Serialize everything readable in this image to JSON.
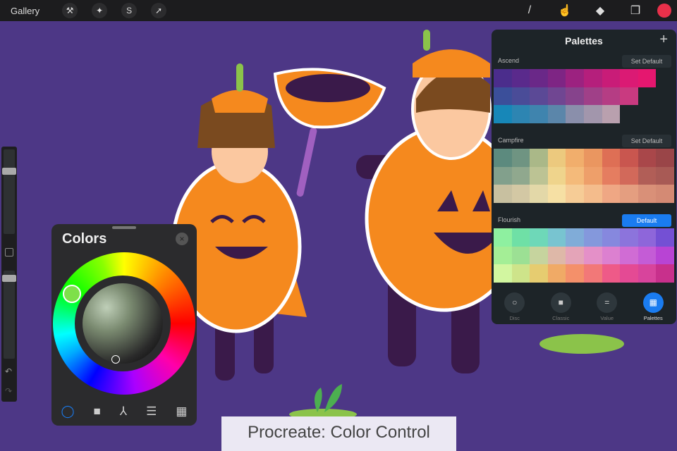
{
  "topbar": {
    "gallery": "Gallery",
    "left_icons": [
      "wrench-icon",
      "magic-wand-icon",
      "selection-icon",
      "transform-arrow-icon"
    ],
    "right_icons": [
      "brush-icon",
      "smudge-icon",
      "eraser-icon",
      "layers-icon"
    ],
    "current_color": "#e8304a"
  },
  "colors_panel": {
    "title": "Colors",
    "close": "×",
    "tabs": [
      "disc-icon",
      "classic-icon",
      "harmony-icon",
      "value-icon",
      "palettes-icon"
    ]
  },
  "palettes_panel": {
    "title": "Palettes",
    "add": "+",
    "palettes": [
      {
        "name": "Ascend",
        "button": "Set Default",
        "rows": [
          [
            "#4b2d8c",
            "#5a2a8c",
            "#6a2888",
            "#7e2584",
            "#9c2280",
            "#b51f7c",
            "#c91c78",
            "#db1a74",
            "#e5176f"
          ],
          [
            "#3b4f9a",
            "#4a4c98",
            "#5b4996",
            "#704692",
            "#86438c",
            "#a04088",
            "#b53d84",
            "#c93a80"
          ],
          [
            "#1787b8",
            "#2d85b2",
            "#3f84ae",
            "#5b86aa",
            "#8a8fab",
            "#a296ac",
            "#b9a0ae"
          ]
        ]
      },
      {
        "name": "Campfire",
        "button": "Set Default",
        "rows": [
          [
            "#5c8a7e",
            "#6f9482",
            "#aab888",
            "#ecc97e",
            "#f1ae6c",
            "#ea9660",
            "#de6f55",
            "#c9564f",
            "#a9474a",
            "#9a4548"
          ],
          [
            "#82a08c",
            "#90a88e",
            "#bcc394",
            "#efd48c",
            "#f4ba7a",
            "#ee9f6a",
            "#e57d60",
            "#d2695a",
            "#b15e57",
            "#a85a55"
          ],
          [
            "#c8c0a0",
            "#d3c8a4",
            "#e3d8a8",
            "#f6e0a4",
            "#f6cc96",
            "#f4bc8c",
            "#efa784",
            "#e49e80",
            "#d99078",
            "#d48a74"
          ]
        ]
      },
      {
        "name": "Flourish",
        "button": "Default",
        "rows": [
          [
            "#8ef0a0",
            "#6fe0a6",
            "#6ed8b8",
            "#78c4d0",
            "#80acd8",
            "#8498dc",
            "#8688de",
            "#8c74dc",
            "#8e66da",
            "#7450d4"
          ],
          [
            "#a4ee96",
            "#9ce094",
            "#c6d49e",
            "#deb8a8",
            "#e4a4b8",
            "#e490c8",
            "#dc80d0",
            "#d06cd4",
            "#c45cd6",
            "#b844d4"
          ],
          [
            "#d2f6a0",
            "#cee48a",
            "#e6cc70",
            "#f0aa66",
            "#f4906a",
            "#f27878",
            "#ee5a88",
            "#e44a94",
            "#d8449c",
            "#c8308c"
          ]
        ]
      }
    ],
    "tabs": [
      {
        "label": "Disc",
        "icon": "○"
      },
      {
        "label": "Classic",
        "icon": "■"
      },
      {
        "label": "Value",
        "icon": "="
      },
      {
        "label": "Palettes",
        "icon": "▦"
      }
    ]
  },
  "caption": "Procreate: Color Control"
}
